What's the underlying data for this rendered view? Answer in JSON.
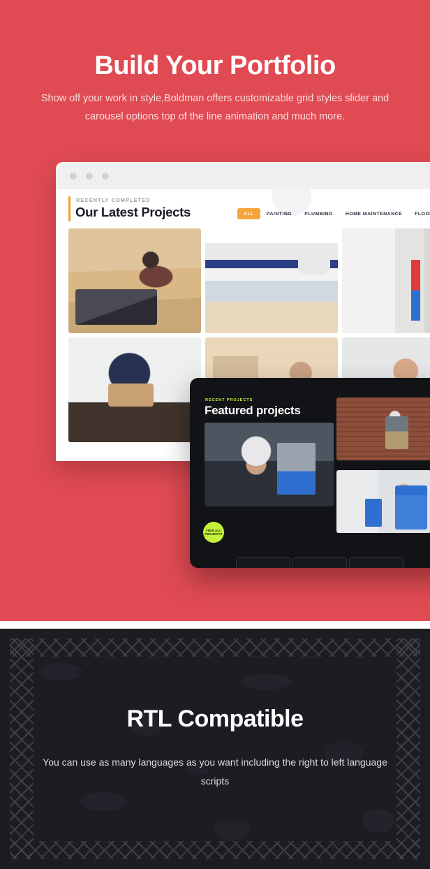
{
  "portfolio": {
    "heading": "Build Your Portfolio",
    "subtext": "Show off your work in style,Boldman offers customizable grid styles slider and carousel options top of the line animation and much more.",
    "accent_red": "#e04a52",
    "browser": {
      "eyebrow": "RECENTLY COMPLETED",
      "title": "Our Latest Projects",
      "accent_orange": "#f5a43c",
      "filters": [
        {
          "label": "ALL",
          "active": true
        },
        {
          "label": "PAINTING",
          "active": false
        },
        {
          "label": "PLUMBING",
          "active": false
        },
        {
          "label": "HOME MAINTENANCE",
          "active": false
        },
        {
          "label": "FLOOR",
          "active": false
        }
      ],
      "photos": [
        {
          "name": "carpenter-miter-saw"
        },
        {
          "name": "ac-unit-servicing"
        },
        {
          "name": "kitchen-wiring"
        },
        {
          "name": "countertop-repair"
        },
        {
          "name": "wall-painting"
        },
        {
          "name": "electrician-portrait"
        }
      ]
    }
  },
  "featured": {
    "eyebrow": "RECENT PROJECTS",
    "title": "Featured projects",
    "accent_lime": "#c4f23a",
    "badge_line1": "VIEW ALL",
    "badge_line2": "PROJECTS",
    "photos": [
      {
        "name": "electrician-hero"
      },
      {
        "name": "brick-wall-worker"
      },
      {
        "name": "water-filter-plumber"
      }
    ]
  },
  "rtl": {
    "heading": "RTL Compatible",
    "subtext": "You can use as many languages as you want including the right to left language scripts",
    "background": "#1c1d23"
  }
}
